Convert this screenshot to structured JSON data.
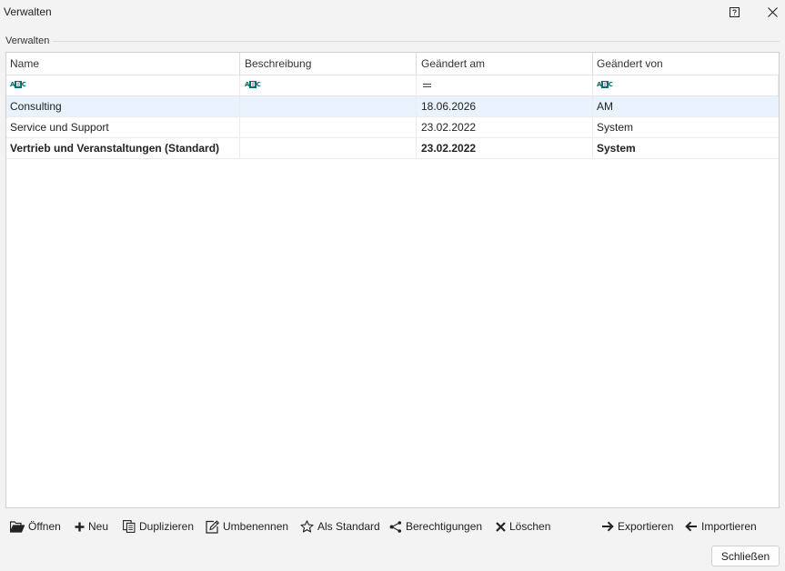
{
  "window": {
    "title": "Verwalten",
    "help_icon": "help-icon",
    "close_icon": "close-icon"
  },
  "group": {
    "label": "Verwalten"
  },
  "grid": {
    "columns": [
      "Name",
      "Beschreibung",
      "Geändert am",
      "Geändert von"
    ],
    "filter_icons": [
      "text-filter-icon",
      "text-filter-icon",
      "equals-filter-icon",
      "text-filter-icon"
    ],
    "rows": [
      [
        "Consulting",
        "",
        "18.06.2026",
        "AM"
      ],
      [
        "Service und Support",
        "",
        "23.02.2022",
        "System"
      ],
      [
        "Vertrieb und Veranstaltungen (Standard)",
        "",
        "23.02.2022",
        "System"
      ]
    ],
    "selected_row": 0,
    "default_row": 2,
    "selection_color": "#eaf3fd"
  },
  "toolbar": {
    "open": "Öffnen",
    "new": "Neu",
    "duplicate": "Duplizieren",
    "rename": "Umbenennen",
    "set_default": "Als Standard",
    "permissions": "Berechtigungen",
    "delete": "Löschen",
    "export": "Exportieren",
    "import": "Importieren"
  },
  "footer": {
    "close_label": "Schließen"
  }
}
